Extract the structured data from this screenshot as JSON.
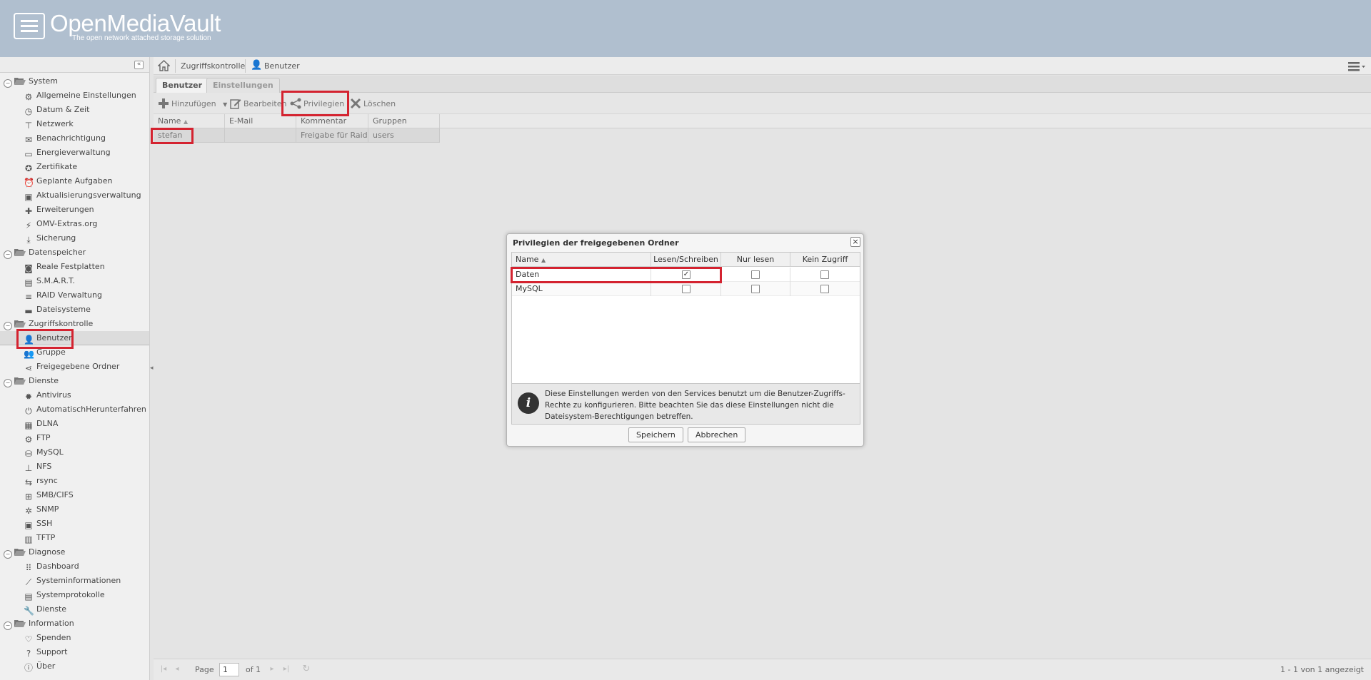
{
  "brand": {
    "title": "OpenMediaVault",
    "subtitle": "The open network attached storage solution"
  },
  "sidebar": {
    "groups": [
      {
        "label": "System",
        "items": [
          "Allgemeine Einstellungen",
          "Datum & Zeit",
          "Netzwerk",
          "Benachrichtigung",
          "Energieverwaltung",
          "Zertifikate",
          "Geplante Aufgaben",
          "Aktualisierungsverwaltung",
          "Erweiterungen",
          "OMV-Extras.org",
          "Sicherung"
        ]
      },
      {
        "label": "Datenspeicher",
        "items": [
          "Reale Festplatten",
          "S.M.A.R.T.",
          "RAID Verwaltung",
          "Dateisysteme"
        ]
      },
      {
        "label": "Zugriffskontrolle",
        "items": [
          "Benutzer",
          "Gruppe",
          "Freigegebene Ordner"
        ]
      },
      {
        "label": "Dienste",
        "items": [
          "Antivirus",
          "AutomatischHerunterfahren",
          "DLNA",
          "FTP",
          "MySQL",
          "NFS",
          "rsync",
          "SMB/CIFS",
          "SNMP",
          "SSH",
          "TFTP"
        ]
      },
      {
        "label": "Diagnose",
        "items": [
          "Dashboard",
          "Systeminformationen",
          "Systemprotokolle",
          "Dienste"
        ]
      },
      {
        "label": "Information",
        "items": [
          "Spenden",
          "Support",
          "Über"
        ]
      }
    ]
  },
  "breadcrumb": {
    "section": "Zugriffskontrolle",
    "page": "Benutzer"
  },
  "tabs": [
    "Benutzer",
    "Einstellungen"
  ],
  "toolbar": {
    "add": "Hinzufügen",
    "edit": "Bearbeiten",
    "privileges": "Privilegien",
    "delete": "Löschen"
  },
  "grid": {
    "columns": [
      "Name",
      "E-Mail",
      "Kommentar",
      "Gruppen"
    ],
    "rows": [
      {
        "name": "stefan",
        "email": "",
        "comment": "Freigabe für Raid",
        "groups": "users"
      }
    ]
  },
  "pager": {
    "page_label": "Page",
    "page_value": "1",
    "of_label": "of 1",
    "summary": "1 - 1 von 1 angezeigt"
  },
  "dialog": {
    "title": "Privilegien der freigegebenen Ordner",
    "columns": [
      "Name",
      "Lesen/Schreiben",
      "Nur lesen",
      "Kein Zugriff"
    ],
    "rows": [
      {
        "name": "Daten",
        "rw": true,
        "ro": false,
        "none": false
      },
      {
        "name": "MySQL",
        "rw": false,
        "ro": false,
        "none": false
      }
    ],
    "info": "Diese Einstellungen werden von den Services benutzt um die Benutzer-Zugriffs-Rechte zu konfigurieren. Bitte beachten Sie das diese Einstellungen nicht die Dateisystem-Berechtigungen betreffen.",
    "save": "Speichern",
    "cancel": "Abbrechen"
  },
  "colors": {
    "header_bg": "#b0bfcf",
    "highlight": "#d42330",
    "page_bg": "#e4e4e4"
  }
}
